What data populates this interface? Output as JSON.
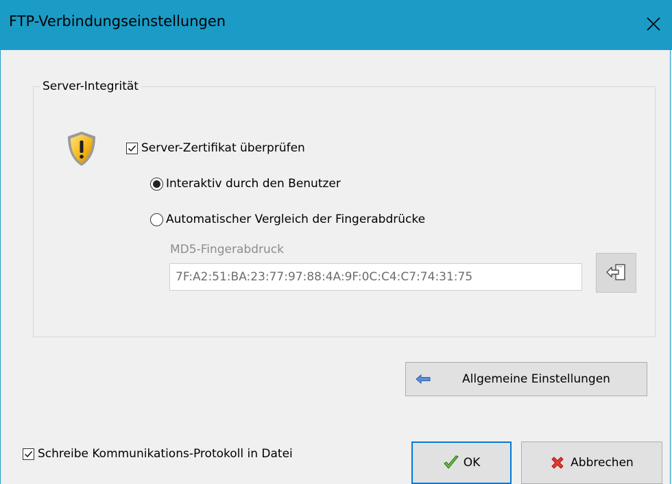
{
  "window": {
    "title": "FTP-Verbindungseinstellungen",
    "accent_color": "#1a9cc7",
    "close_icon": "close-icon"
  },
  "server_integrity": {
    "group_title": "Server-Integrität",
    "warning_icon": "shield-warning-icon",
    "verify_certificate": {
      "label": "Server-Zertifikat überprüfen",
      "checked": true
    },
    "options": [
      {
        "label": "Interaktiv durch den Benutzer",
        "selected": true
      },
      {
        "label": "Automatischer Vergleich der Fingerabdrücke",
        "selected": false
      }
    ],
    "md5": {
      "label": "MD5-Fingerabdruck",
      "value": "7F:A2:51:BA:23:77:97:88:4A:9F:0C:C4:C7:74:31:75",
      "disabled": true
    },
    "paste_icon": "paste-arrow-icon"
  },
  "buttons": {
    "general_settings": "Allgemeine Einstellungen",
    "ok": "OK",
    "cancel": "Abbrechen"
  },
  "log_to_file": {
    "label": "Schreibe Kommunikations-Protokoll in Datei",
    "checked": true
  }
}
